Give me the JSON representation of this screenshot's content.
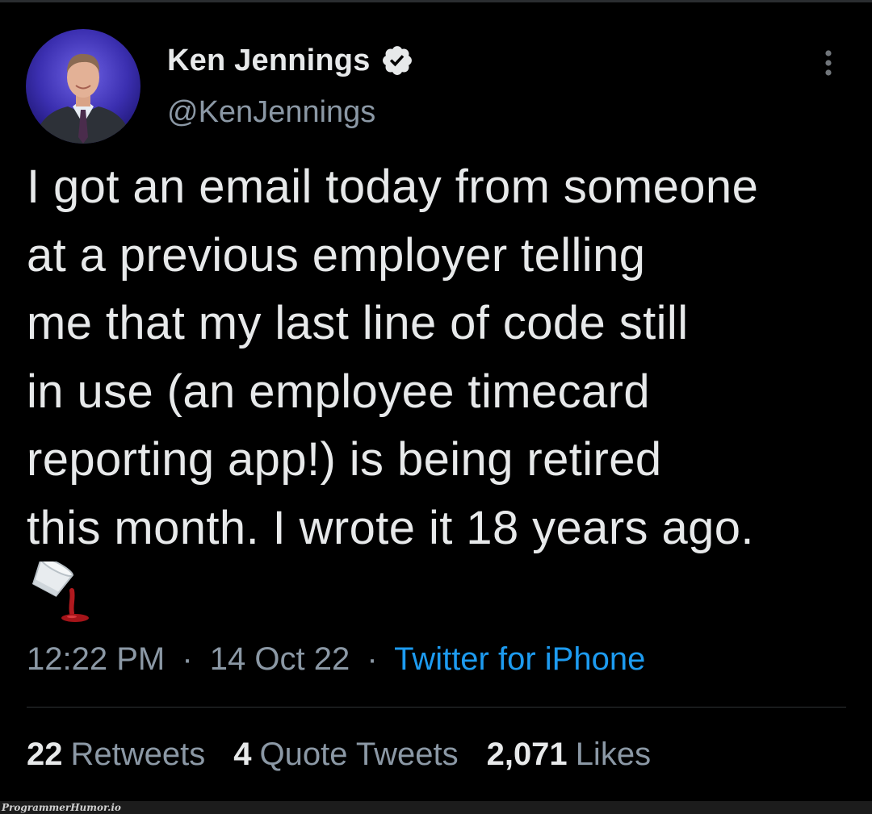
{
  "tweet": {
    "author": {
      "display_name": "Ken Jennings",
      "handle": "@KenJennings",
      "verified_icon": "verified-badge-icon"
    },
    "text_lines": [
      "I got an email today from someone",
      "at a previous employer telling",
      "me that my last line of code still",
      "in use (an employee timecard",
      "reporting app!) is being retired",
      "this month. I wrote it 18 years ago."
    ],
    "emoji_icon": "spilled-drink-icon",
    "time": "12:22 PM",
    "separator": "·",
    "date": "14 Oct 22",
    "source": "Twitter for iPhone",
    "stats": [
      {
        "count": "22",
        "label": "Retweets"
      },
      {
        "count": "4",
        "label": "Quote Tweets"
      },
      {
        "count": "2,071",
        "label": "Likes"
      }
    ]
  },
  "watermark": "ProgrammerHumor.io",
  "colors": {
    "background": "#000000",
    "primary_text": "#e7e9ea",
    "secondary_text": "#8b98a5",
    "link": "#1d9bf0",
    "divider": "#2f3336"
  }
}
